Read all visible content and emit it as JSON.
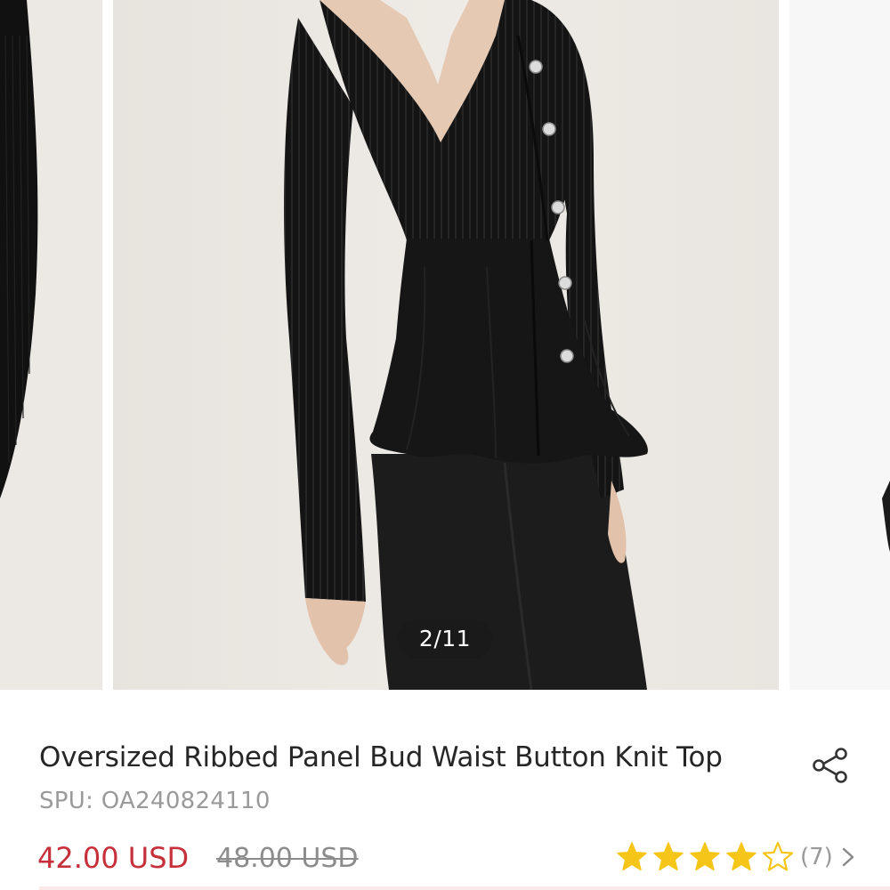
{
  "carousel": {
    "counter": "2/11",
    "current_index": 2,
    "total": 11
  },
  "product": {
    "title": "Oversized Ribbed Panel Bud Waist Button Knit Top",
    "spu": "SPU: OA240824110",
    "price_current": "42.00 USD",
    "price_original": "48.00 USD",
    "rating": 4,
    "rating_max": 5,
    "review_count": "(7)"
  },
  "icons": {
    "share": "share-icon",
    "star": "star-icon",
    "chevron": "chevron-right-icon"
  },
  "colors": {
    "price": "#c6303a",
    "star": "#f5c518",
    "muted_text": "#9a9a9a",
    "title_text": "#262626",
    "backdrop": "#ebe7e2"
  }
}
